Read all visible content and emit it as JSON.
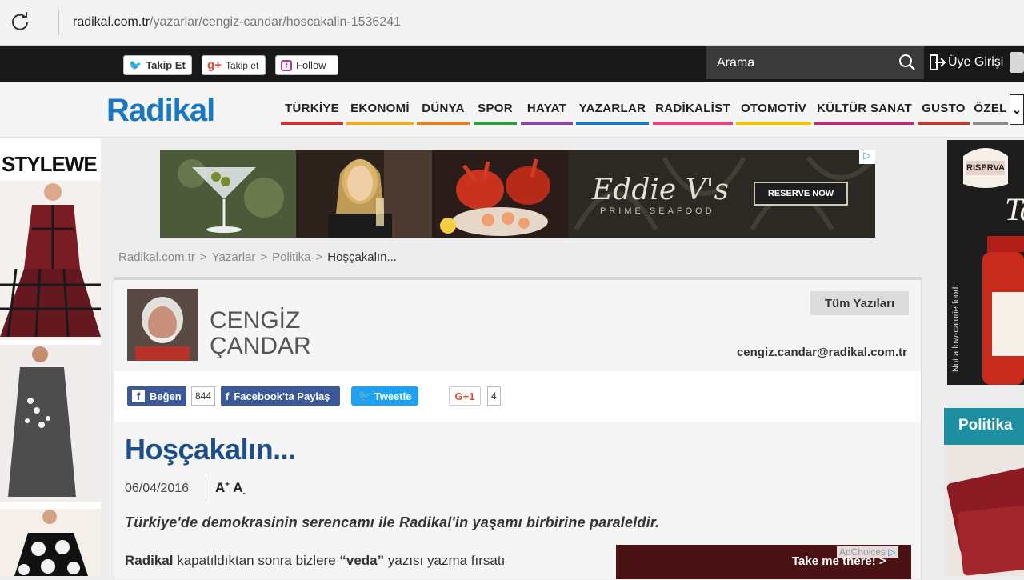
{
  "browser": {
    "url_host": "radikal.com.tr",
    "url_path": "/yazarlar/cengiz-candar/hoscakalin-1536241"
  },
  "topbar": {
    "twitter_label": "Takip Et",
    "gplus_label": "Takip et",
    "follow_label": "Follow",
    "search_placeholder": "Arama",
    "login_label": "Üye Girişi"
  },
  "nav": {
    "logo": "Radikal",
    "items": [
      {
        "label": "TÜRKİYE",
        "color": "#d32f2f"
      },
      {
        "label": "EKONOMİ",
        "color": "#f5a623"
      },
      {
        "label": "DÜNYA",
        "color": "#e67e22"
      },
      {
        "label": "SPOR",
        "color": "#2e9a3e"
      },
      {
        "label": "HAYAT",
        "color": "#8e44ad"
      },
      {
        "label": "YAZARLAR",
        "color": "#1a78c2"
      },
      {
        "label": "RADİKALİST",
        "color": "#e8437a"
      },
      {
        "label": "OTOMOTİV",
        "color": "#f2c200"
      },
      {
        "label": "KÜLTÜR SANAT",
        "color": "#b5316e"
      },
      {
        "label": "GUSTO",
        "color": "#c0392b"
      },
      {
        "label": "ÖZEL",
        "color": "#8a8a8a"
      }
    ]
  },
  "ads": {
    "left_brand": "STYLEWE",
    "banner_brand": "Eddie V's",
    "banner_sub": "PRIME SEAFOOD",
    "banner_button": "RESERVE NOW",
    "inline_text": "Take me there! >",
    "adchoices": "AdChoices"
  },
  "sidebar": {
    "section_title": "Politika"
  },
  "breadcrumb": {
    "items": [
      "Radikal.com.tr",
      "Yazarlar",
      "Politika",
      "Hoşçakalın..."
    ]
  },
  "author": {
    "name_line1": "CENGİZ",
    "name_line2": "ÇANDAR",
    "all_posts": "Tüm Yazıları",
    "email": "cengiz.candar@radikal.com.tr"
  },
  "share": {
    "like_label": "Beğen",
    "like_count": "844",
    "fb_share": "Facebook'ta Paylaş",
    "tweet": "Tweetle",
    "gplus": "G+1",
    "gplus_count": "4"
  },
  "article": {
    "title": "Hoşçakalın...",
    "date": "06/04/2016",
    "font_increase": "A",
    "font_decrease": "A",
    "lead": "Türkiye'de demokrasinin serencamı ile Radikal'in yaşamı birbirine paraleldir.",
    "para_bold1": "Radikal",
    "para_text1": " kapatıldıktan sonra bizlere ",
    "para_bold2": "“veda”",
    "para_text2": " yazısı yazma fırsatı"
  }
}
